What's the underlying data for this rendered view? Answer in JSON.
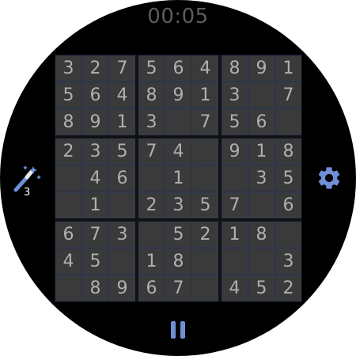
{
  "timer": "00:05",
  "hint": {
    "count": "3",
    "icon": "magic-wand-icon"
  },
  "settings": {
    "icon": "gear-icon",
    "color": "#6f8fd6"
  },
  "pause": {
    "icon": "pause-icon",
    "color": "#6f8fd6"
  },
  "grid": [
    [
      "3",
      "2",
      "7",
      "5",
      "6",
      "4",
      "8",
      "9",
      "1"
    ],
    [
      "5",
      "6",
      "4",
      "8",
      "9",
      "1",
      "3",
      "",
      "7"
    ],
    [
      "8",
      "9",
      "1",
      "3",
      "",
      "7",
      "5",
      "6",
      ""
    ],
    [
      "2",
      "3",
      "5",
      "7",
      "4",
      "",
      "9",
      "1",
      "8"
    ],
    [
      "",
      "4",
      "6",
      "",
      "1",
      "",
      "",
      "3",
      "5"
    ],
    [
      "",
      "1",
      "",
      "2",
      "3",
      "5",
      "7",
      "",
      "6"
    ],
    [
      "6",
      "7",
      "3",
      "",
      "5",
      "2",
      "1",
      "8",
      ""
    ],
    [
      "4",
      "5",
      "",
      "1",
      "8",
      "",
      "",
      "",
      "3"
    ],
    [
      "",
      "8",
      "9",
      "6",
      "7",
      "",
      "4",
      "5",
      "2"
    ]
  ]
}
